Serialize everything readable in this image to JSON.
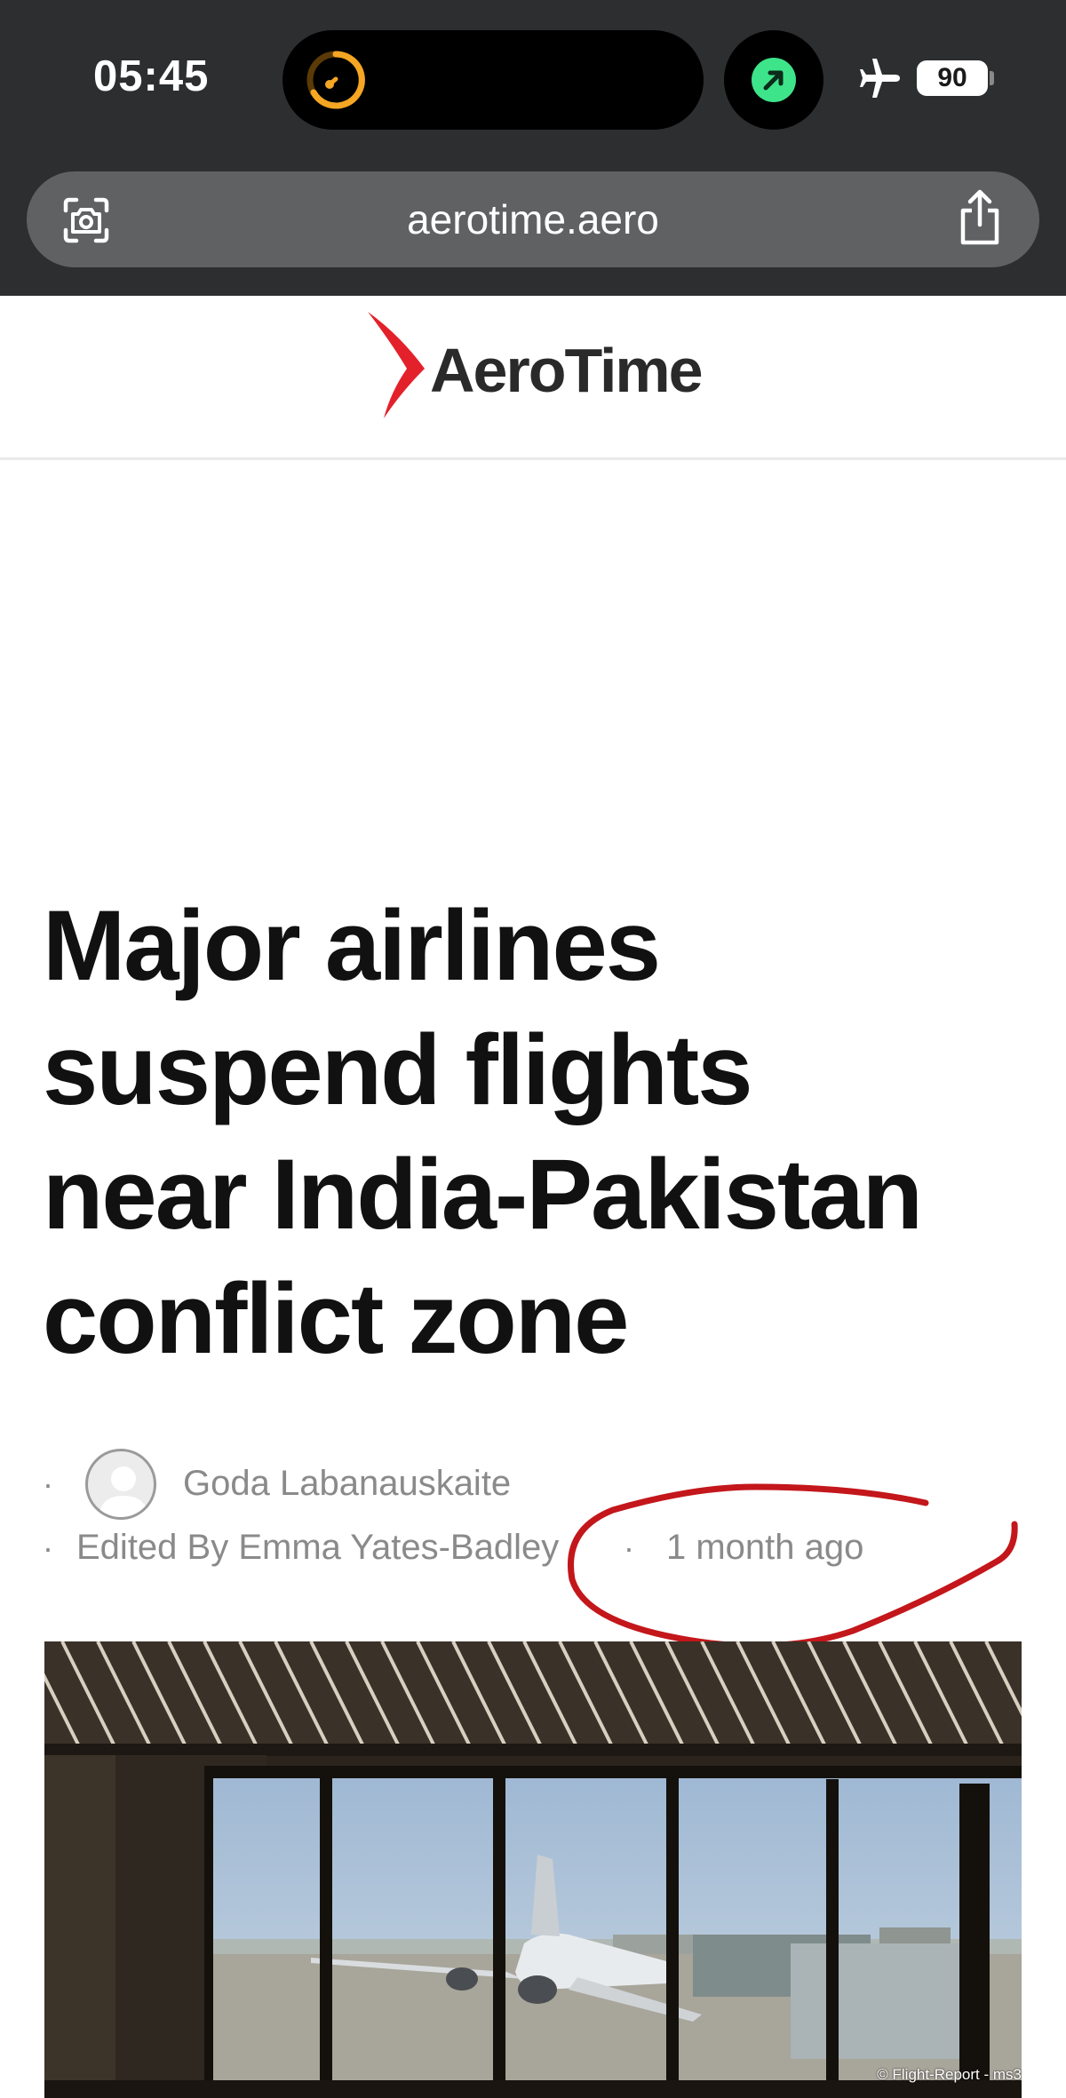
{
  "status_bar": {
    "time": "05:45",
    "battery": "90"
  },
  "browser": {
    "url": "aerotime.aero"
  },
  "site": {
    "logo_text": "AeroTime",
    "brand_color": "#e3212b"
  },
  "article": {
    "headline_lines": [
      "Major airlines",
      "suspend flights",
      "near India-Pakistan",
      "conflict zone"
    ],
    "author": "Goda Labanauskaite",
    "editor": "Edited By Emma Yates-Badley",
    "time_ago": "1 month ago",
    "separator": "·"
  },
  "hero_image": {
    "watermark": "© Flight-Report - ms3"
  },
  "icons": {
    "timer": "timer-icon",
    "navigation": "navigation-arrow-icon",
    "airplane_mode": "airplane-icon",
    "lens": "visual-lookup-icon",
    "share": "share-icon"
  },
  "colors": {
    "chrome_bg": "#2c2e30",
    "urlbar_bg": "#5f6163",
    "annotation_red": "#c3171b",
    "nav_green": "#3ee48a",
    "timer_orange": "#f5a623"
  }
}
